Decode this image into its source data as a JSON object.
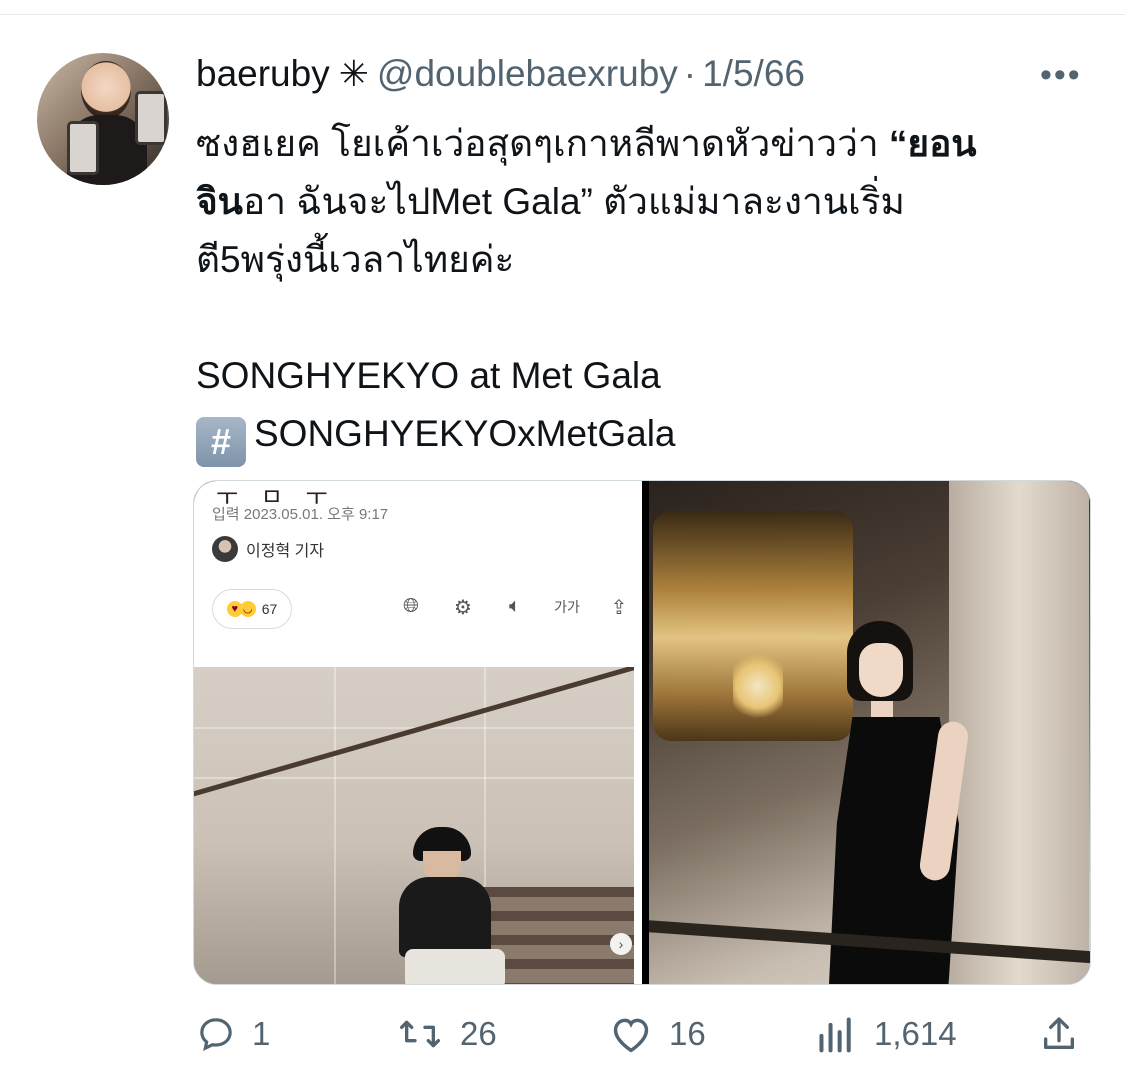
{
  "tweet": {
    "author_name": "baeruby",
    "verified_glyph": "✳",
    "handle": "@doublebaexruby",
    "separator": "·",
    "date": "1/5/66",
    "more_glyph": "•••",
    "text": {
      "line1_pre": "ซงฮเยค โยเค้าเว่อสุดๆเกาหลีพาดหัวข่าวว่า ",
      "line1_bold": "“ยอน",
      "line2_bold": "จิน",
      "line2_rest": "อา ฉันจะไปMet Gala” ตัวแม่มาละงานเริ่ม",
      "line3": "ตี5พรุ่งนี้เวลาไทยค่ะ",
      "line4": "SONGHYEKYO at Met Gala",
      "hashtag_glyph": "#",
      "hashtag": "SONGHYEKYOxMetGala"
    }
  },
  "media": {
    "left_image": {
      "cutoff_text": "ㅜ ㅁ ㅜ",
      "date_line": "입력 2023.05.01. 오후 9:17",
      "reporter": "이정혁 기자",
      "reaction_count": "67",
      "tool_font_label": "가가",
      "next_glyph": "›"
    },
    "right_image": {}
  },
  "actions": {
    "reply_count": "1",
    "retweet_count": "26",
    "like_count": "16",
    "view_count": "1,614"
  },
  "colors": {
    "text_primary": "#0f1419",
    "text_secondary": "#536471",
    "border": "#cfd9de"
  },
  "icons": [
    "verified-icon",
    "more-icon",
    "reply-icon",
    "retweet-icon",
    "like-icon",
    "views-icon",
    "share-icon",
    "globe-icon",
    "robot-icon",
    "speaker-icon",
    "font-size-icon",
    "share-article-icon"
  ]
}
